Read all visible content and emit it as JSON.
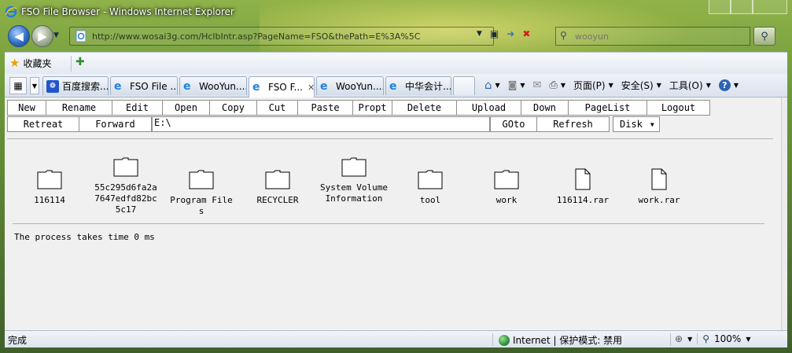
{
  "window": {
    "title": "FSO File Browser - Windows Internet Explorer"
  },
  "nav": {
    "address_url": "http://www.wosai3g.com/HclbIntr.asp?PageName=FSO&thePath=E%3A%5C",
    "search_placeholder": "wooyun"
  },
  "favorites": {
    "label": "收藏夹"
  },
  "tabs": [
    {
      "label": "百度搜索...",
      "icon": "baidu-icon"
    },
    {
      "label": "FSO File ...",
      "icon": "ie-icon"
    },
    {
      "label": "WooYun....",
      "icon": "ie-icon"
    },
    {
      "label": "FSO F...",
      "icon": "ie-icon",
      "active": true
    },
    {
      "label": "WooYun....",
      "icon": "ie-icon"
    },
    {
      "label": "中华会计...",
      "icon": "ie-icon"
    }
  ],
  "command_bar": {
    "page": "页面(P)",
    "safety": "安全(S)",
    "tools": "工具(O)"
  },
  "fso": {
    "toolbar": [
      "New",
      "Rename",
      "Edit",
      "Open",
      "Copy",
      "Cut",
      "Paste",
      "Propt",
      "Delete",
      "Upload",
      "Down",
      "PageList",
      "Logout"
    ],
    "nav_buttons": {
      "retreat": "Retreat",
      "forward": "Forward",
      "goto": "GOto",
      "refresh": "Refresh"
    },
    "path": "E:\\",
    "disk": "Disk",
    "files": [
      {
        "name": "116114",
        "type": "folder"
      },
      {
        "name": "55c295d6fa2a7647edfd82bc5c17",
        "type": "folder"
      },
      {
        "name": "Program Files",
        "type": "folder"
      },
      {
        "name": "RECYCLER",
        "type": "folder"
      },
      {
        "name": "System Volume Information",
        "type": "folder"
      },
      {
        "name": "tool",
        "type": "folder"
      },
      {
        "name": "work",
        "type": "folder"
      },
      {
        "name": "116114.rar",
        "type": "file"
      },
      {
        "name": "work.rar",
        "type": "file"
      }
    ],
    "process_text": "The process takes time 0 ms"
  },
  "status": {
    "left": "完成",
    "zone": "Internet | 保护模式: 禁用",
    "zoom": "100%"
  }
}
